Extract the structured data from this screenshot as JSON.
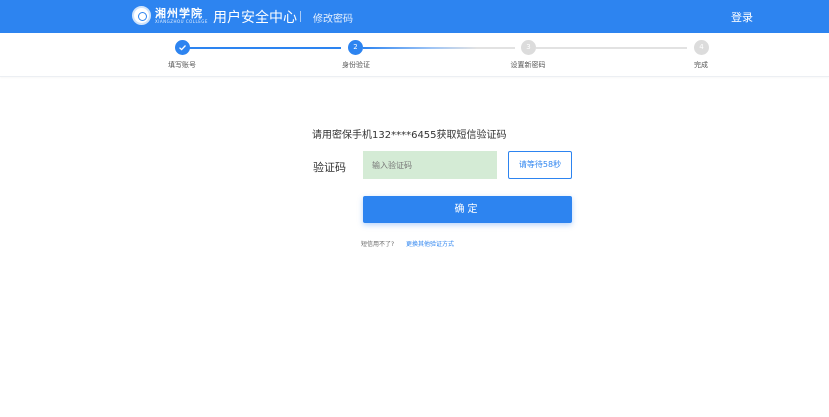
{
  "header": {
    "logo_text_cn": "湘州学院",
    "logo_text_en": "XIANGZHOU COLLEGE",
    "app_title": "用户安全中心",
    "subtitle": "修改密码",
    "login_label": "登录"
  },
  "steps": {
    "items": [
      {
        "number": "1",
        "label": "填写账号",
        "state": "done"
      },
      {
        "number": "2",
        "label": "身份验证",
        "state": "active"
      },
      {
        "number": "3",
        "label": "设置新密码",
        "state": "todo"
      },
      {
        "number": "4",
        "label": "完成",
        "state": "todo"
      }
    ]
  },
  "verify": {
    "instruction": "请用密保手机132****6455获取短信验证码",
    "code_label": "验证码",
    "code_placeholder": "输入验证码",
    "code_value": "",
    "wait_button": "请等待58秒",
    "confirm_button": "确定",
    "tip_text": "短信用不了?",
    "tip_link": "更换其他验证方式"
  },
  "colors": {
    "primary": "#2d84f0",
    "input_bg": "#d4ebd5",
    "step_todo": "#dcdcdc"
  }
}
